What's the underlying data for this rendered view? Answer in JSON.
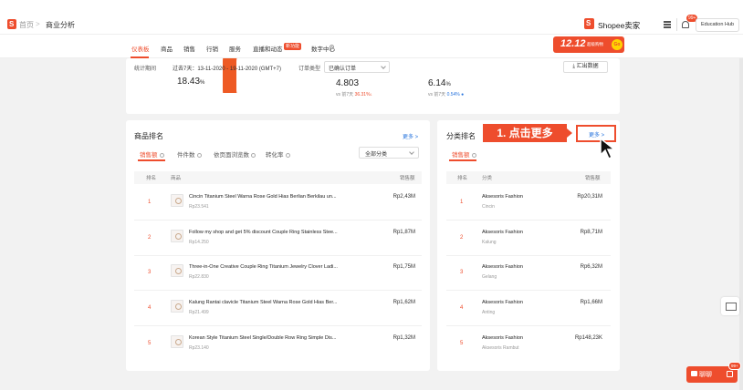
{
  "breadcrumb": {
    "home": "首页",
    "separator": ">",
    "current": "商业分析"
  },
  "header": {
    "brand": "Shopee卖家",
    "notification_badge": "99+",
    "education_hub": "Education Hub"
  },
  "nav": {
    "tabs": [
      "仪表板",
      "商品",
      "销售",
      "行销",
      "服务",
      "直播和动态",
      "数字中心"
    ],
    "badge": "新功能",
    "active": "仪表板"
  },
  "promo": {
    "title": "12.12",
    "subtitle": "超级购物",
    "go": "Go"
  },
  "filters": {
    "period_label": "统计期间",
    "period_value": "过去7天：13-11-2020 - 19-11-2020 (GMT+7)",
    "order_label": "订单类型",
    "order_value": "已确认订单",
    "export": "汇出数据"
  },
  "stats": [
    {
      "value": "18.43",
      "unit": "%"
    },
    {
      "value": "4.803",
      "unit": "",
      "compare_label": "vs 前7天",
      "change": "36.31%",
      "direction": "down"
    },
    {
      "value": "6.14",
      "unit": "%",
      "compare_label": "vs 前7天",
      "change": "0.54%",
      "direction": "up"
    }
  ],
  "product_ranking": {
    "title": "商品排名",
    "more": "更多 >",
    "tabs": [
      "销售额",
      "件件数",
      "依页面浏览数",
      "转化率"
    ],
    "category_select": "全部分类",
    "columns": {
      "rank": "排名",
      "product": "商品",
      "sales": "销售额"
    },
    "rows": [
      {
        "rank": "1",
        "name": "Cincin Titanium Steel Warna Rose Gold Hias Berlian Berkilau un...",
        "price": "Rp23.541",
        "sales": "Rp2,43M"
      },
      {
        "rank": "2",
        "name": "Follow my shop and get 5% discount Couple Ring Stainless Stee...",
        "price": "Rp14.250",
        "sales": "Rp1,87M"
      },
      {
        "rank": "3",
        "name": "Three-in-One Creative Couple Ring Titanium Jewelry Clover Ladi...",
        "price": "Rp22.830",
        "sales": "Rp1,75M"
      },
      {
        "rank": "4",
        "name": "Kalung Rantai clavicle Titanium Steel Warna Rose Gold Hias Ber...",
        "price": "Rp21.499",
        "sales": "Rp1,62M"
      },
      {
        "rank": "5",
        "name": "Korean Style Titanium Steel Single/Double Row Ring Simple Dis...",
        "price": "Rp23.140",
        "sales": "Rp1,32M"
      }
    ]
  },
  "category_ranking": {
    "title": "分类排名",
    "more": "更多 >",
    "tab": "销售额",
    "columns": {
      "rank": "排名",
      "category": "分类",
      "sales": "销售额"
    },
    "rows": [
      {
        "rank": "1",
        "name": "Aksesoris Fashion",
        "sub": "Cincin",
        "sales": "Rp20,31M"
      },
      {
        "rank": "2",
        "name": "Aksesoris Fashion",
        "sub": "Kalung",
        "sales": "Rp8,71M"
      },
      {
        "rank": "3",
        "name": "Aksesoris Fashion",
        "sub": "Gelang",
        "sales": "Rp6,32M"
      },
      {
        "rank": "4",
        "name": "Aksesoris Fashion",
        "sub": "Anting",
        "sales": "Rp1,66M"
      },
      {
        "rank": "5",
        "name": "Aksesoris Fashion",
        "sub": "Aksesoris Rambut",
        "sales": "Rp148,23K"
      }
    ]
  },
  "callout": "1. 点击更多",
  "chat": {
    "label": "聊聊",
    "badge": "99+"
  }
}
